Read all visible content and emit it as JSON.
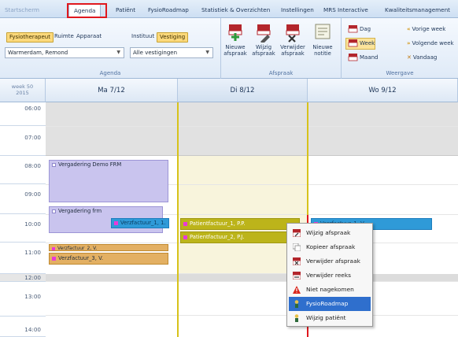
{
  "tabs": [
    {
      "label": "Startscherm"
    },
    {
      "label": "Agenda"
    },
    {
      "label": "Patiënt"
    },
    {
      "label": "FysioRoadmap"
    },
    {
      "label": "Statistiek & Overzichten"
    },
    {
      "label": "Instellingen"
    },
    {
      "label": "MRS Interactive"
    },
    {
      "label": "Kwaliteitsmanagement"
    }
  ],
  "ribbon": {
    "agenda_group": {
      "label": "Agenda",
      "filter_chips": {
        "fysiotherapeut": "Fysiotherapeut",
        "ruimte": "Ruimte",
        "apparaat": "Apparaat",
        "instituut": "Instituut",
        "vestiging": "Vestiging"
      },
      "therapist_value": "Warmerdam, Remond",
      "location_value": "Alle vestigingen"
    },
    "afspraak_group": {
      "label": "Afspraak",
      "buttons": [
        {
          "line1": "Nieuwe",
          "line2": "afspraak"
        },
        {
          "line1": "Wijzig",
          "line2": "afspraak"
        },
        {
          "line1": "Verwijder",
          "line2": "afspraak"
        },
        {
          "line1": "Nieuwe",
          "line2": "notitie"
        }
      ]
    },
    "weergave_group": {
      "label": "Weergave",
      "view_buttons": [
        "Dag",
        "Week",
        "Maand"
      ],
      "selected_view": "Week",
      "nav_buttons": [
        "Vorige week",
        "Volgende week",
        "Vandaag"
      ]
    }
  },
  "calendar": {
    "week_label": "week 50",
    "year_label": "2015",
    "days": [
      "Ma 7/12",
      "Di 8/12",
      "Wo 9/12"
    ],
    "times": [
      "06:00",
      "07:00",
      "08:00",
      "09:00",
      "10:00",
      "11:00",
      "12:00",
      "13:00",
      "14:00"
    ],
    "appointments": {
      "mon_meeting_1": "Vergadering Demo FRM",
      "mon_meeting_2": "Vergadering frm",
      "mon_invoice_1": "Verzfactuur_1, 1.",
      "mon_invoice_2": "Verzfactuur_2, V.",
      "mon_invoice_3": "Verzfactuur_3, V.",
      "tue_invoice_1": "Patientfactuur_1, P.P.",
      "tue_invoice_2": "Patientfactuur_2, P.J.",
      "wed_invoice_1": "Verzfactuur_1, V."
    }
  },
  "context_menu": {
    "items": [
      {
        "label": "Wijzig afspraak",
        "icon": "calendar-edit-icon"
      },
      {
        "label": "Kopieer afspraak",
        "icon": "copy-icon"
      },
      {
        "label": "Verwijder afspraak",
        "icon": "calendar-delete-icon"
      },
      {
        "label": "Verwijder reeks",
        "icon": "calendar-series-delete-icon"
      },
      {
        "label": "Niet nagekomen",
        "icon": "warning-icon"
      },
      {
        "label": "FysioRoadmap",
        "icon": "roadmap-icon"
      },
      {
        "label": "Wijzig patiënt",
        "icon": "patient-edit-icon"
      }
    ],
    "highlighted_item": "FysioRoadmap"
  },
  "colors": {
    "accent_red": "#e0181e",
    "meeting_purple": "#c9c4ee",
    "invoice_tan": "#e3b063",
    "invoice_olive": "#bcb41a",
    "invoice_blue": "#2f9ad8",
    "menu_highlight": "#2f6fcd"
  }
}
